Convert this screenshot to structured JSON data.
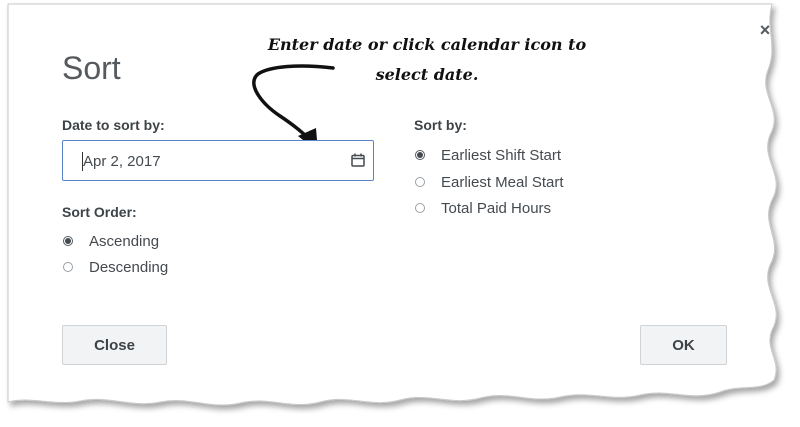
{
  "dialog": {
    "title": "Sort",
    "close_glyph": "×"
  },
  "annotation": {
    "line1": "Enter date or click calendar icon to",
    "line2": "select date."
  },
  "date_field": {
    "label": "Date to sort by:",
    "value": "Apr 2, 2017",
    "icon": "calendar-icon"
  },
  "sort_order": {
    "label": "Sort Order:",
    "options": [
      {
        "label": "Ascending",
        "checked": true
      },
      {
        "label": "Descending",
        "checked": false
      }
    ]
  },
  "sort_by": {
    "label": "Sort by:",
    "options": [
      {
        "label": "Earliest Shift Start",
        "checked": true
      },
      {
        "label": "Earliest Meal Start",
        "checked": false
      },
      {
        "label": "Total Paid Hours",
        "checked": false
      }
    ]
  },
  "buttons": {
    "close_label": "Close",
    "ok_label": "OK"
  },
  "colors": {
    "input_border": "#5a86c9",
    "text": "#444a4f",
    "button_bg": "#f2f3f4"
  }
}
